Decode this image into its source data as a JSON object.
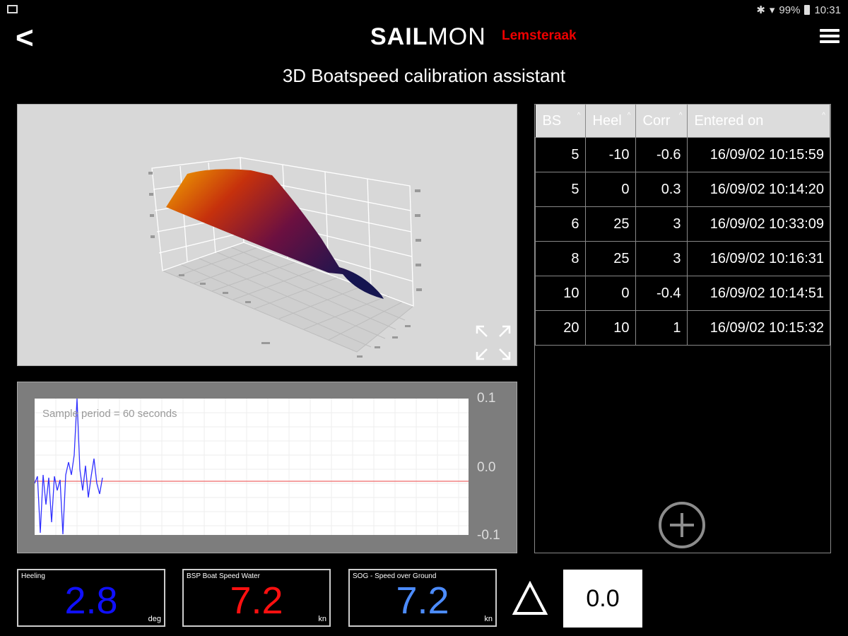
{
  "status": {
    "battery": "99%",
    "time": "10:31"
  },
  "header": {
    "logo_bold": "SAIL",
    "logo_light": "MON",
    "boat": "Lemsteraak",
    "back_label": "<",
    "title": "3D Boatspeed calibration assistant"
  },
  "table": {
    "columns": [
      "BS",
      "Heel",
      "Corr",
      "Entered on"
    ],
    "rows": [
      [
        "5",
        "-10",
        "-0.6",
        "16/09/02 10:15:59"
      ],
      [
        "5",
        "0",
        "0.3",
        "16/09/02 10:14:20"
      ],
      [
        "6",
        "25",
        "3",
        "16/09/02 10:33:09"
      ],
      [
        "8",
        "25",
        "3",
        "16/09/02 10:16:31"
      ],
      [
        "10",
        "0",
        "-0.4",
        "16/09/02 10:14:51"
      ],
      [
        "20",
        "10",
        "1",
        "16/09/02 10:15:32"
      ]
    ]
  },
  "sample": {
    "label": "Sample period = 60 seconds",
    "y_max": "0.1",
    "y_mid": "0.0",
    "y_min": "-0.1"
  },
  "gauges": [
    {
      "label": "Heeling",
      "value": "2.8",
      "unit": "deg",
      "color": "#1010ff"
    },
    {
      "label": "BSP Boat Speed Water",
      "value": "7.2",
      "unit": "kn",
      "color": "#ff1010"
    },
    {
      "label": "SOG - Speed over Ground",
      "value": "7.2",
      "unit": "kn",
      "color": "#4c8cff"
    }
  ],
  "delta_value": "0.0",
  "colors": {
    "boat_name": "#e00000",
    "accent_grey": "#8c8c8c"
  }
}
